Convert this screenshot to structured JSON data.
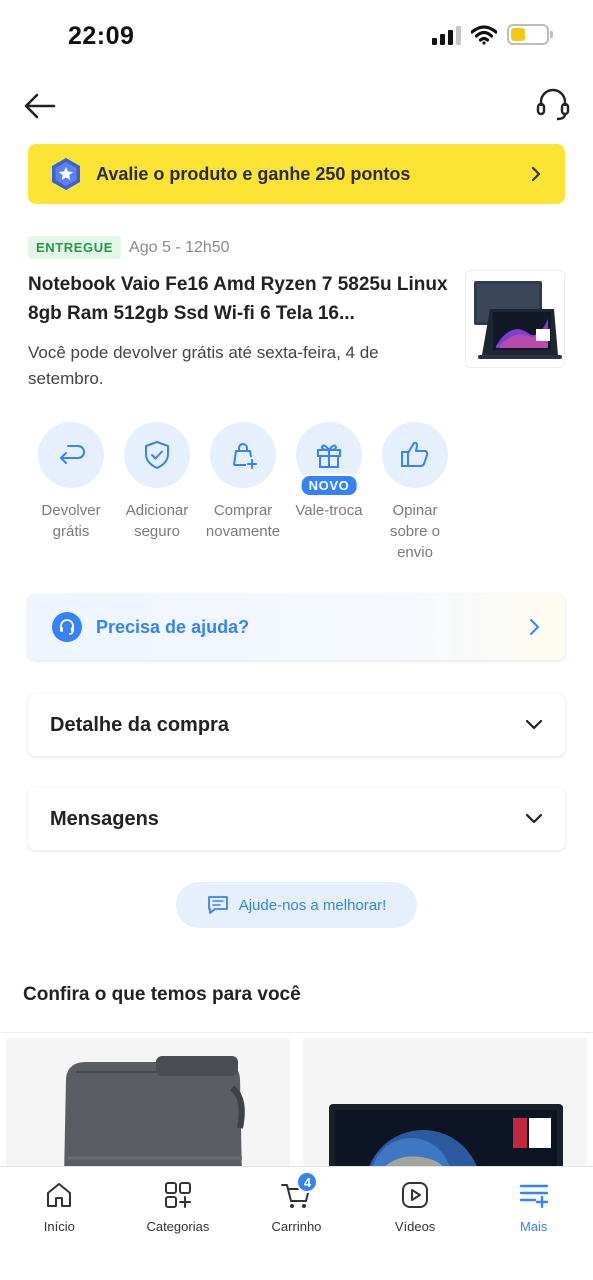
{
  "status_bar": {
    "time": "22:09"
  },
  "reward_banner": {
    "text": "Avalie o produto e ganhe 250 pontos"
  },
  "order": {
    "status_badge": "ENTREGUE",
    "date": "Ago 5 - 12h50",
    "product_title": "Notebook Vaio Fe16 Amd Ryzen 7 5825u Linux 8gb Ram 512gb Ssd Wi-fi 6 Tela 16...",
    "return_note": "Você pode devolver grátis até sexta-feira, 4 de setembro."
  },
  "actions": [
    {
      "line1": "Devolver",
      "line2": "grátis",
      "line3": "",
      "icon": "return-icon"
    },
    {
      "line1": "Adicionar",
      "line2": "seguro",
      "line3": "",
      "icon": "shield-check-icon"
    },
    {
      "line1": "Comprar",
      "line2": "novamente",
      "line3": "",
      "icon": "bag-plus-icon"
    },
    {
      "line1": "Vale-troca",
      "line2": "",
      "line3": "",
      "icon": "gift-icon",
      "badge": "NOVO"
    },
    {
      "line1": "Opinar",
      "line2": "sobre o",
      "line3": "envio",
      "icon": "thumbs-up-icon"
    }
  ],
  "help_card": {
    "text": "Precisa de ajuda?"
  },
  "sections": {
    "details": "Detalhe da compra",
    "messages": "Mensagens"
  },
  "feedback_button": {
    "text": "Ajude-nos a melhorar!"
  },
  "recommendations": {
    "title": "Confira o que temos para você"
  },
  "bottom_nav": [
    {
      "label": "Início",
      "icon": "home-icon"
    },
    {
      "label": "Categorias",
      "icon": "categories-icon"
    },
    {
      "label": "Carrinho",
      "icon": "cart-icon",
      "badge": "4"
    },
    {
      "label": "Vídeos",
      "icon": "video-icon"
    },
    {
      "label": "Mais",
      "icon": "menu-plus-icon",
      "active": true
    }
  ],
  "colors": {
    "accent": "#3483fa",
    "banner": "#fde333",
    "delivered_green": "#1f9d45"
  }
}
